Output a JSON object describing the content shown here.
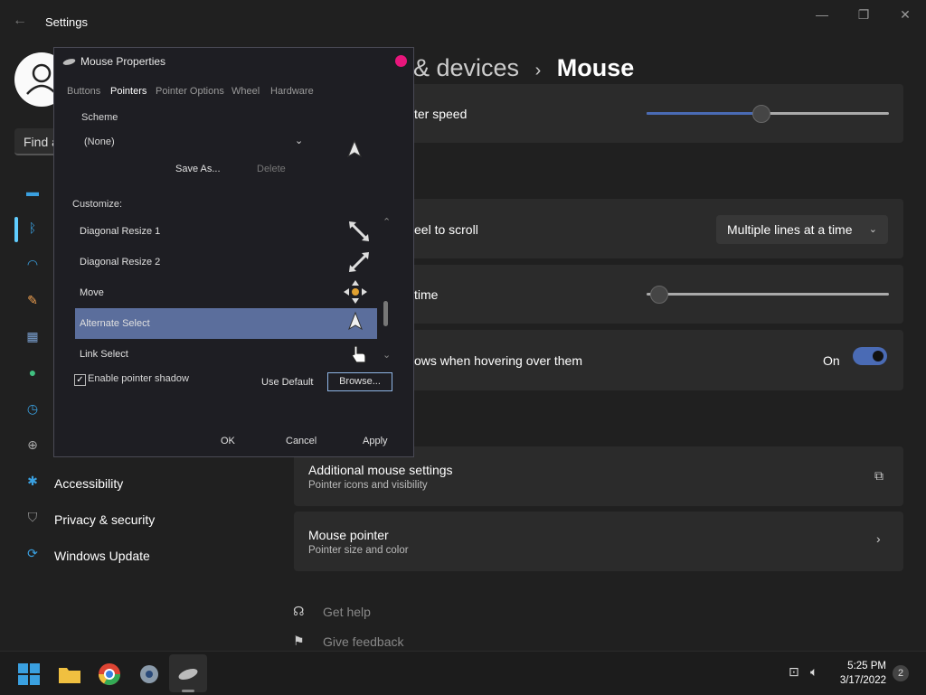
{
  "settings": {
    "app_title": "Settings",
    "find_placeholder": "Find a",
    "page_title_prefix": "& devices",
    "page_title_sep": "›",
    "page_title_current": "Mouse",
    "nav": [
      {
        "label": "",
        "icon": "monitor-icon"
      },
      {
        "label": "",
        "icon": "bluetooth-icon",
        "selected": true
      },
      {
        "label": "",
        "icon": "wifi-icon"
      },
      {
        "label": "",
        "icon": "brush-icon"
      },
      {
        "label": "",
        "icon": "apps-icon"
      },
      {
        "label": "",
        "icon": "person-icon"
      },
      {
        "label": "",
        "icon": "clock-icon"
      },
      {
        "label": "",
        "icon": "gamepad-icon"
      },
      {
        "label": "Accessibility",
        "icon": "accessibility-icon"
      },
      {
        "label": "Privacy & security",
        "icon": "shield-icon"
      },
      {
        "label": "Windows Update",
        "icon": "update-icon"
      }
    ],
    "cards": {
      "pointer_speed": {
        "label": "ter speed",
        "value": 0.5
      },
      "wheel_scroll": {
        "label": "eel to scroll",
        "dropdown": "Multiple lines at a time"
      },
      "lines_time": {
        "label": "time",
        "value": 0.02
      },
      "hover_scroll": {
        "label": "ows when hovering over them",
        "state": "On"
      },
      "additional": {
        "title": "Additional mouse settings",
        "sub": "Pointer icons and visibility"
      },
      "pointer": {
        "title": "Mouse pointer",
        "sub": "Pointer size and color"
      }
    },
    "help": {
      "get_help": "Get help",
      "feedback": "Give feedback"
    }
  },
  "dialog": {
    "title": "Mouse Properties",
    "tabs": [
      "Buttons",
      "Pointers",
      "Pointer Options",
      "Wheel",
      "Hardware"
    ],
    "selected_tab": "Pointers",
    "scheme_label": "Scheme",
    "scheme_value": "(None)",
    "save_as": "Save As...",
    "delete": "Delete",
    "customize_label": "Customize:",
    "list": [
      {
        "label": "Diagonal Resize 1",
        "icon": "diag-resize1-icon"
      },
      {
        "label": "Diagonal Resize 2",
        "icon": "diag-resize2-icon"
      },
      {
        "label": "Move",
        "icon": "move-icon"
      },
      {
        "label": "Alternate Select",
        "icon": "alt-select-icon",
        "selected": true
      },
      {
        "label": "Link Select",
        "icon": "link-select-icon"
      }
    ],
    "shadow_label": "Enable pointer shadow",
    "shadow_checked": true,
    "use_default": "Use Default",
    "browse": "Browse...",
    "ok": "OK",
    "cancel": "Cancel",
    "apply": "Apply"
  },
  "taskbar": {
    "time": "5:25 PM",
    "date": "3/17/2022",
    "notifications": "2"
  },
  "colors": {
    "accent": "#4a6bb5",
    "selection": "#5b6e9c",
    "close": "#e8167c"
  }
}
